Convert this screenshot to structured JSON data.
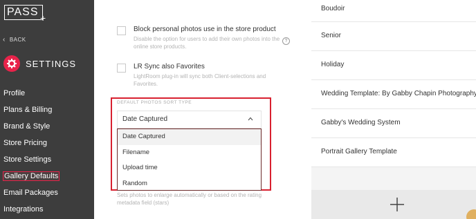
{
  "brand": {
    "logo_text": "PASS",
    "accent_color": "#e8234a"
  },
  "sidebar": {
    "back_label": "BACK",
    "settings_title": "SETTINGS",
    "items": [
      {
        "label": "Profile"
      },
      {
        "label": "Plans & Billing"
      },
      {
        "label": "Brand & Style"
      },
      {
        "label": "Store Pricing"
      },
      {
        "label": "Store Settings"
      },
      {
        "label": "Gallery Defaults",
        "active": true
      },
      {
        "label": "Email Packages"
      },
      {
        "label": "Integrations"
      }
    ]
  },
  "options": {
    "block_personal": {
      "title": "Block personal photos use in the store product",
      "description": "Disable the option for users to add their own photos into the online store products.",
      "checked": false
    },
    "lr_sync": {
      "title": "LR Sync also Favorites",
      "description": "LightRoom plug-in will sync both Client-selections and Favorites.",
      "checked": false
    }
  },
  "sort": {
    "label": "DEFAULT PHOTOS SORT TYPE",
    "selected": "Date Captured",
    "options": [
      "Date Captured",
      "Filename",
      "Upload time",
      "Random"
    ]
  },
  "bottom_description": "Sets photos to enlarge automatically or based on the rating metadata field (stars)",
  "templates": [
    "Boudoir",
    "Senior",
    "Holiday",
    "Wedding Template: By Gabby Chapin Photography",
    "Gabby's Wedding System",
    "Portrait Gallery Template"
  ],
  "icons": {
    "back": "chevron-left-icon",
    "settings": "gear-icon",
    "help": "help-icon",
    "caret": "chevron-up-icon",
    "add": "plus-icon"
  }
}
